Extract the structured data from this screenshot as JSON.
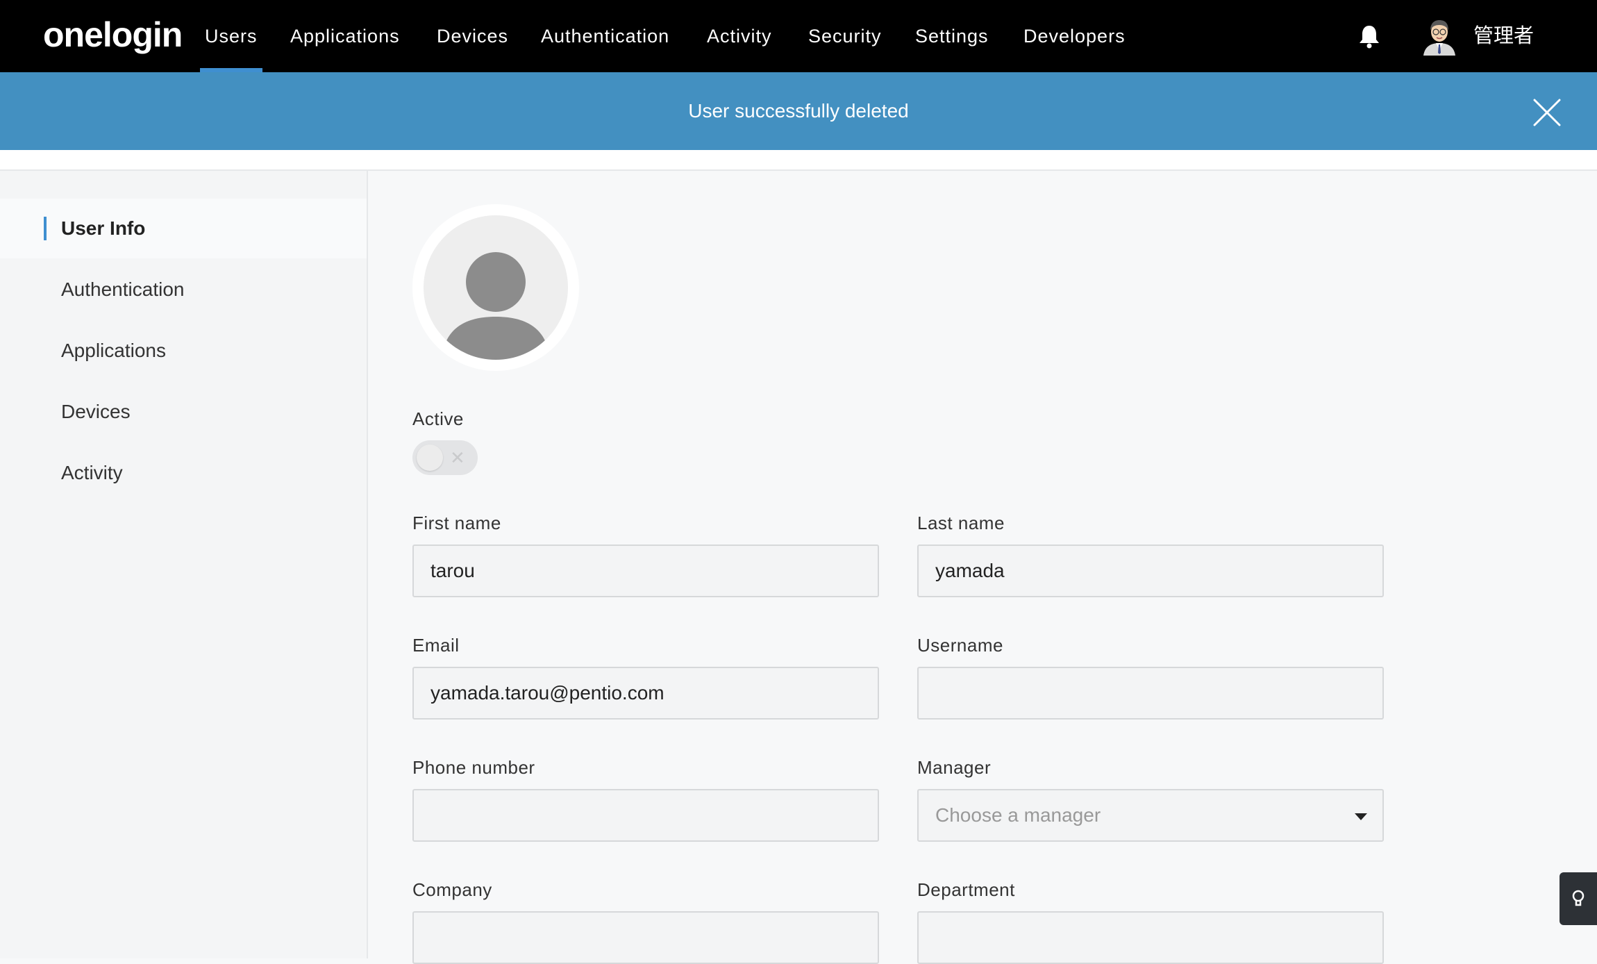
{
  "brand": {
    "logo": "onelogin"
  },
  "nav": {
    "items": [
      {
        "label": "Users",
        "active": true
      },
      {
        "label": "Applications"
      },
      {
        "label": "Devices"
      },
      {
        "label": "Authentication"
      },
      {
        "label": "Activity"
      },
      {
        "label": "Security"
      },
      {
        "label": "Settings"
      },
      {
        "label": "Developers"
      }
    ],
    "user_name": "管理者",
    "accent": "#3f8fd0"
  },
  "banner": {
    "message": "User successfully deleted",
    "color": "#4390c1"
  },
  "sidebar": {
    "items": [
      {
        "label": "User Info",
        "active": true
      },
      {
        "label": "Authentication"
      },
      {
        "label": "Applications"
      },
      {
        "label": "Devices"
      },
      {
        "label": "Activity"
      }
    ]
  },
  "form": {
    "active": {
      "label": "Active",
      "on": false
    },
    "first_name": {
      "label": "First name",
      "value": "tarou"
    },
    "last_name": {
      "label": "Last name",
      "value": "yamada"
    },
    "email": {
      "label": "Email",
      "value": "yamada.tarou@pentio.com"
    },
    "username": {
      "label": "Username",
      "value": ""
    },
    "phone": {
      "label": "Phone number",
      "value": ""
    },
    "manager": {
      "label": "Manager",
      "placeholder": "Choose a manager"
    },
    "company": {
      "label": "Company",
      "value": ""
    },
    "department": {
      "label": "Department",
      "value": ""
    }
  },
  "icons": [
    "bell-icon",
    "avatar-icon",
    "close-icon",
    "user-placeholder-icon",
    "chevron-down-icon",
    "lightbulb-icon"
  ]
}
